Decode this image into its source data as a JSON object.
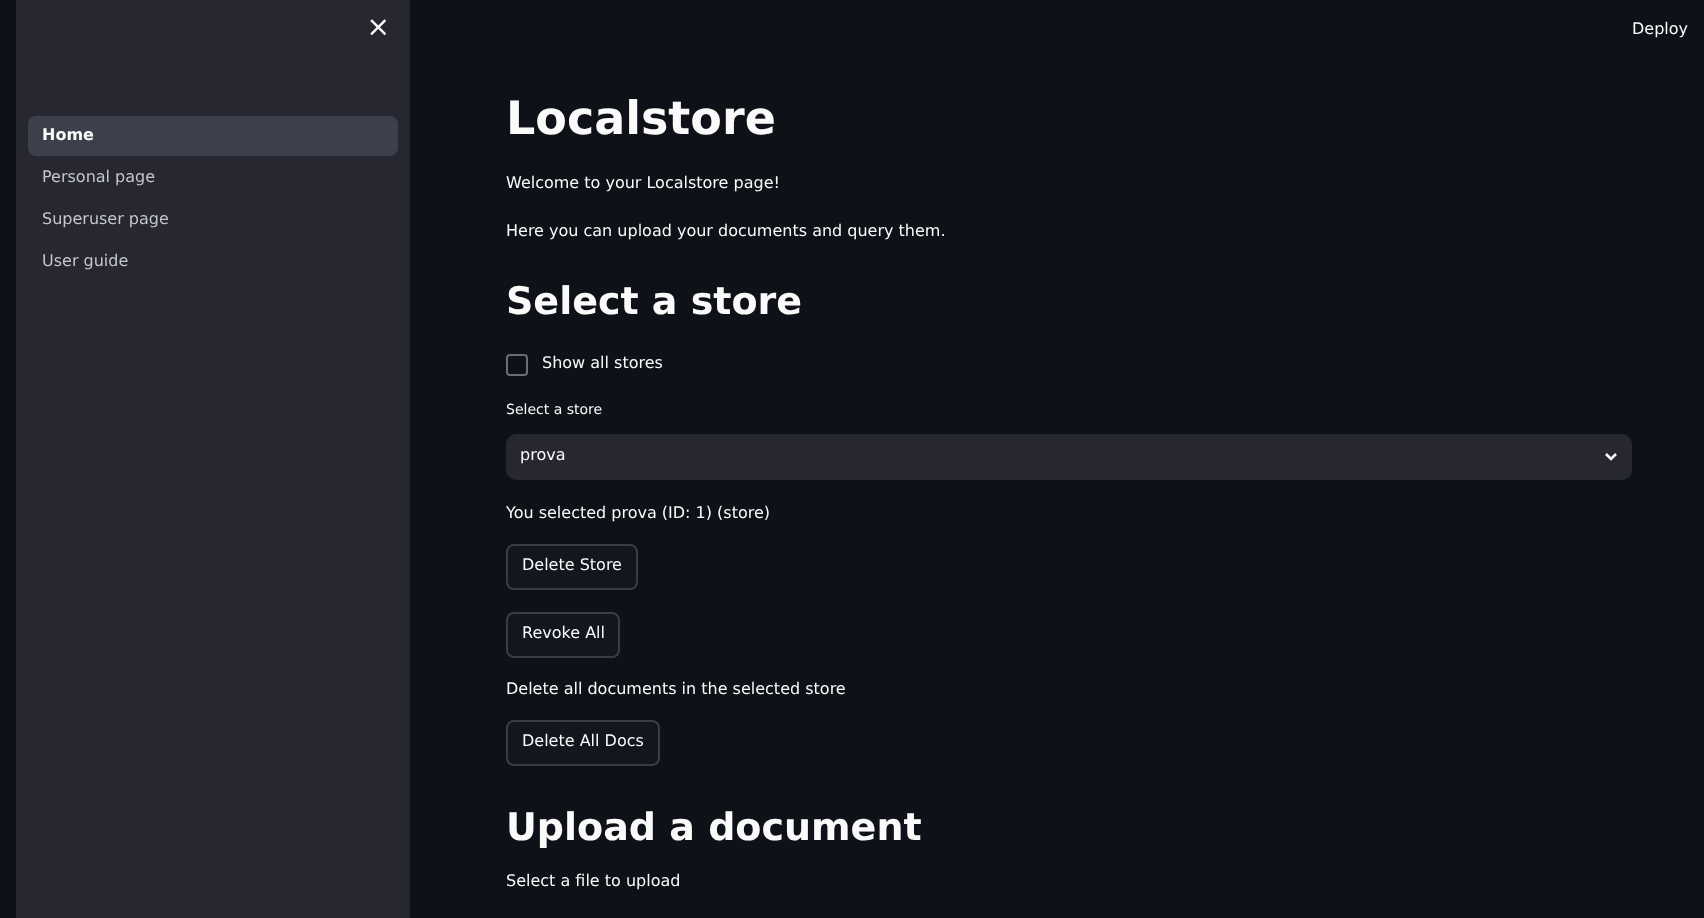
{
  "sidebar": {
    "close": "×",
    "items": [
      {
        "label": "Home",
        "selected": true
      },
      {
        "label": "Personal page",
        "selected": false
      },
      {
        "label": "Superuser page",
        "selected": false
      },
      {
        "label": "User guide",
        "selected": false
      }
    ]
  },
  "header": {
    "deploy": "Deploy"
  },
  "main": {
    "title": "Localstore",
    "intro": [
      "Welcome to your Localstore page!",
      "Here you can upload your documents and query them."
    ],
    "store_heading": "Select a store",
    "show_all": {
      "label": "Show all stores",
      "checked": false
    },
    "store_select": {
      "label": "Select a store",
      "value": "prova"
    },
    "selection_text": "You selected prova (ID: 1) (store)",
    "buttons_1": [
      "Delete Store",
      "Revoke All"
    ],
    "delete_all_text": "Delete all documents in the selected store",
    "buttons_2": [
      "Delete All Docs"
    ],
    "upload_heading": "Upload a document",
    "upload_label": "Select a file to upload"
  }
}
